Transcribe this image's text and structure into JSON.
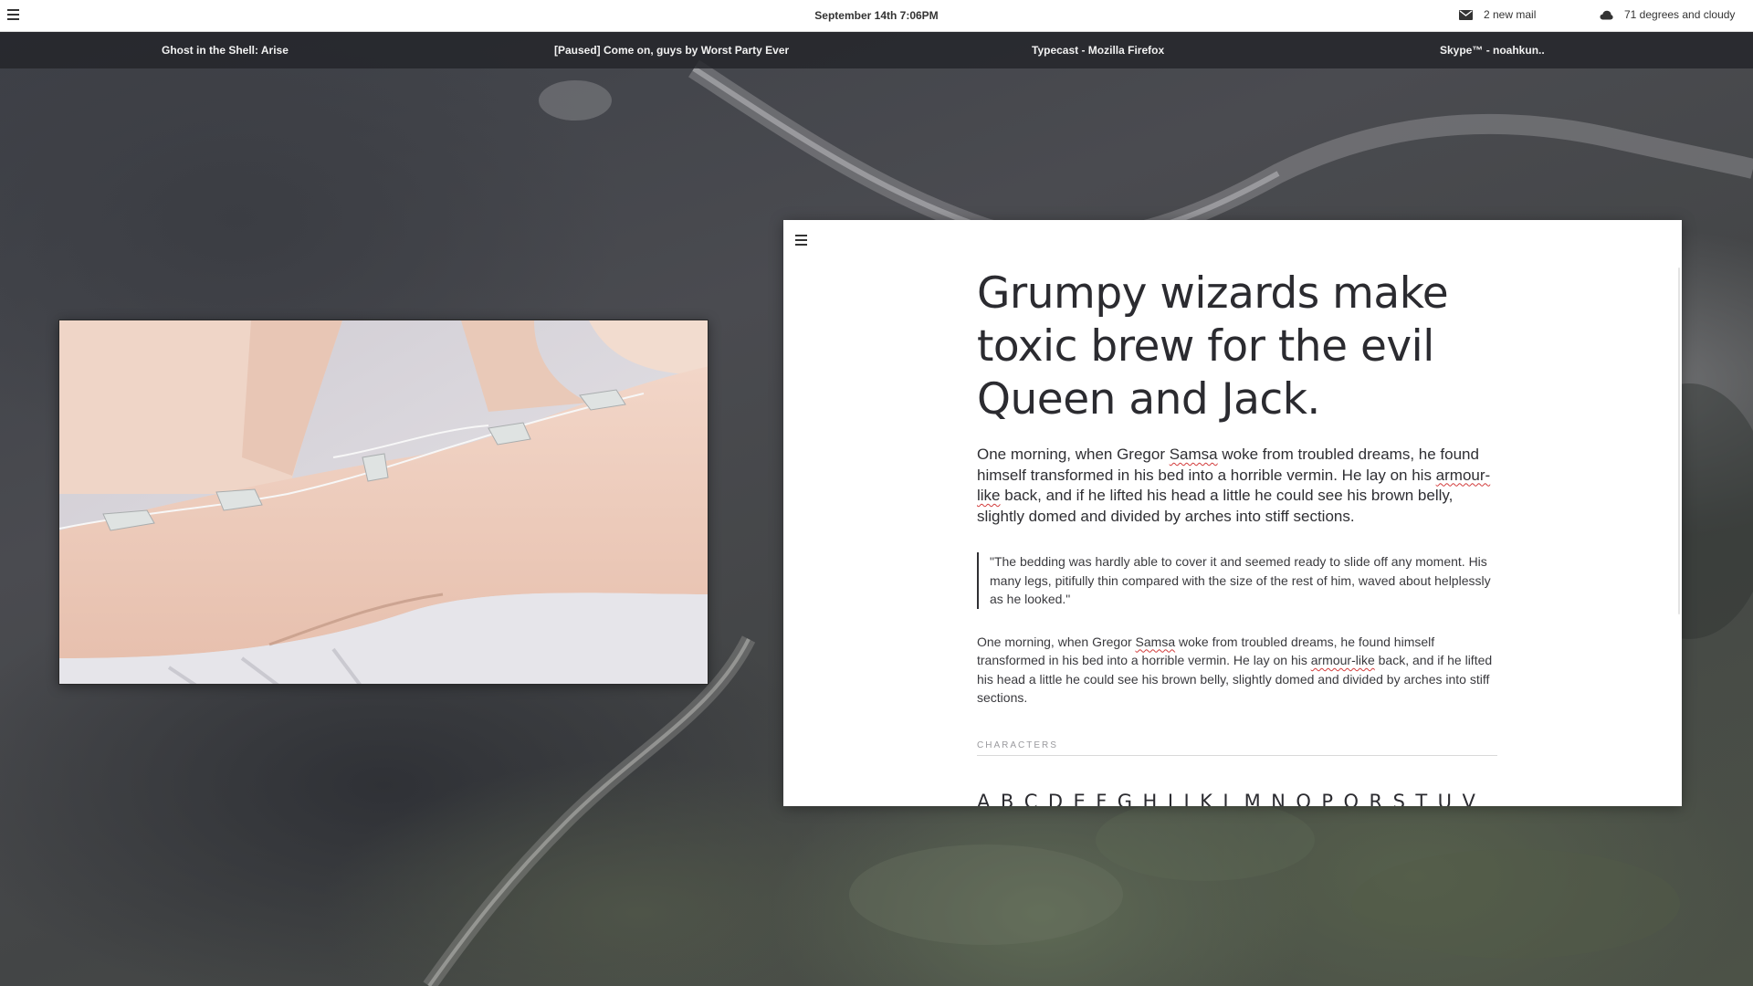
{
  "top_panel": {
    "menu_icon": "hamburger-icon",
    "clock": "September 14th 7:06PM",
    "mail": {
      "icon": "mail-icon",
      "label": "2 new mail"
    },
    "weather": {
      "icon": "cloud-icon",
      "label": "71 degrees and cloudy"
    }
  },
  "taskbar": {
    "tasks": [
      {
        "label": "Ghost in the Shell: Arise"
      },
      {
        "label": "[Paused] Come on, guys by Worst Party Ever"
      },
      {
        "label": "Typecast - Mozilla Firefox"
      },
      {
        "label": "Skype™ - noahkun.."
      }
    ]
  },
  "document": {
    "menu_icon": "hamburger-icon",
    "title": "Grumpy wizards make toxic brew for the evil Queen and Jack.",
    "lead": {
      "p1": "One morning, when Gregor ",
      "w1": "Samsa",
      "p2": " woke from troubled dreams, he found himself transformed in his bed into a horrible vermin. He lay on his ",
      "w2": "armour-like",
      "p3": " back, and if he lifted his head a little he could see his brown belly, slightly domed and divided by arches into stiff sections."
    },
    "quote": "\"The bedding was hardly able to cover it and seemed ready to slide off any moment. His many legs, pitifully thin compared with the size of the rest of him, waved about helplessly as he looked.\"",
    "body": {
      "p1": "One morning, when Gregor ",
      "w1": "Samsa",
      "p2": " woke from troubled dreams, he found himself transformed in his bed into a horrible vermin. He lay on his ",
      "w2": "armour-like",
      "p3": " back, and if he lifted his head a little he could see his brown belly, slightly domed and divided by arches into stiff sections."
    },
    "section_label": "CHARACTERS",
    "alphabet": "A B C D E F G H I J K L M N O P Q R S T U V X Y Z"
  },
  "colors": {
    "panel_bg": "#ffffff",
    "taskbar_bg": "#232529",
    "spellcheck": "#d23c3c"
  }
}
